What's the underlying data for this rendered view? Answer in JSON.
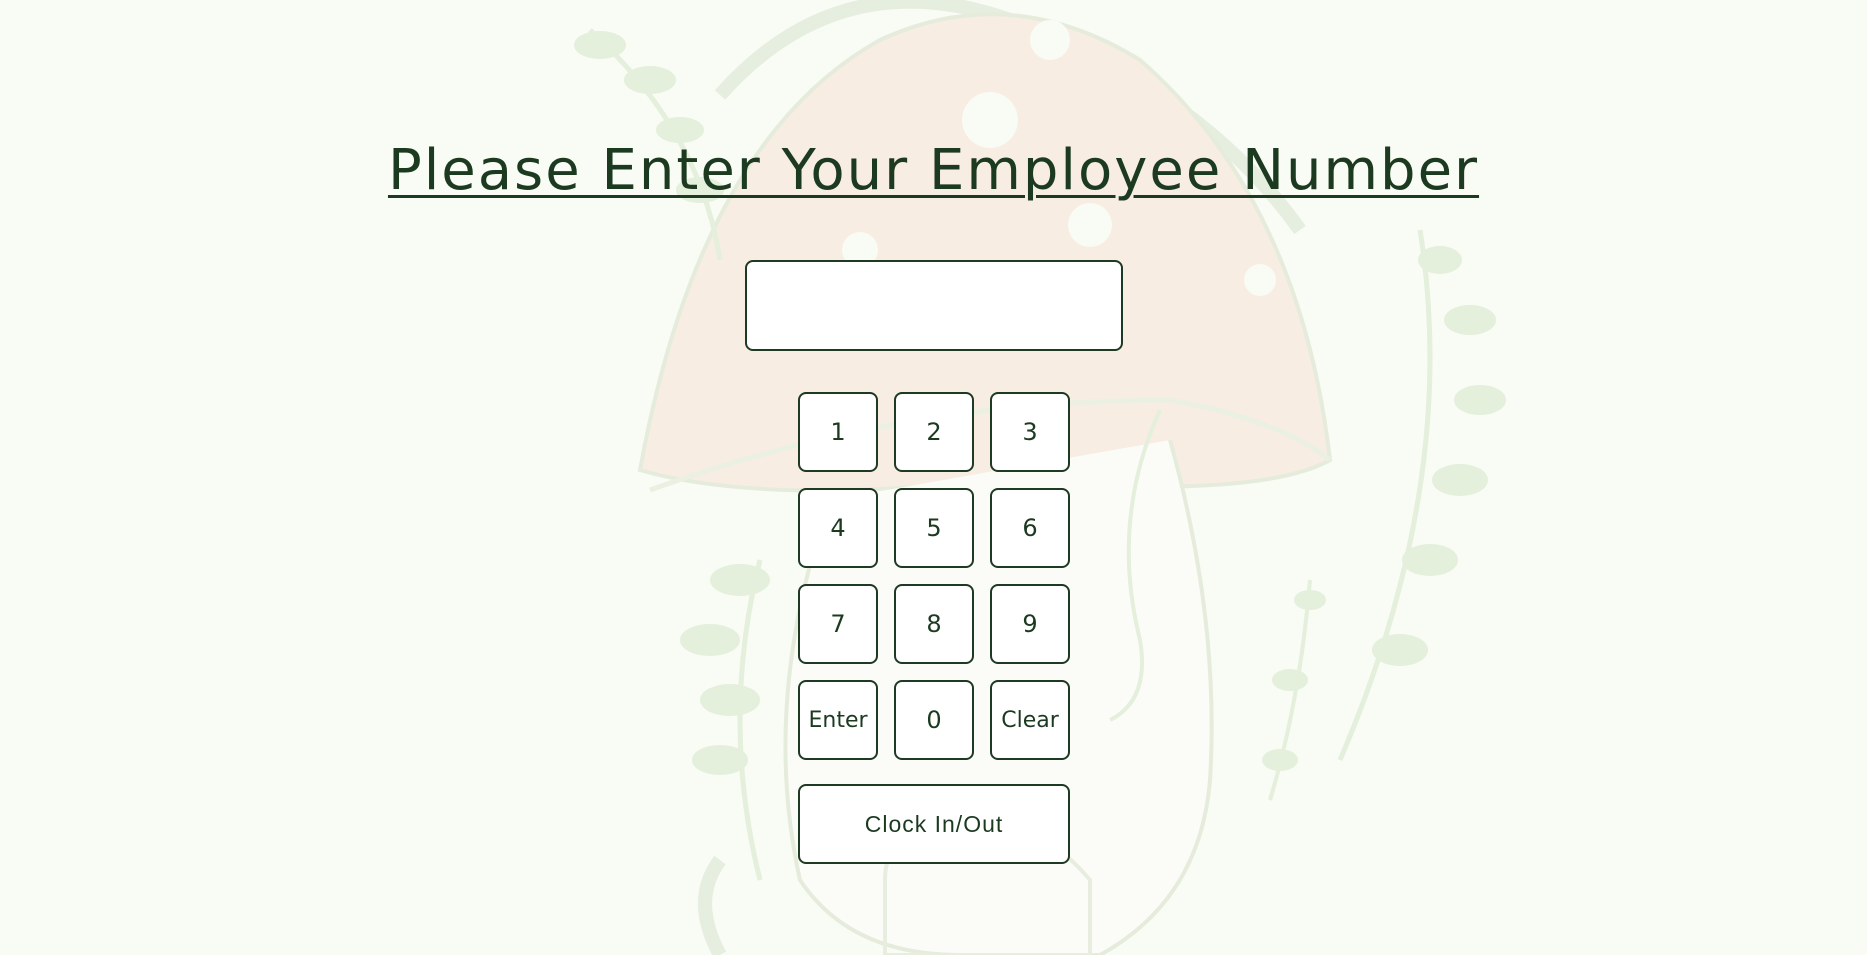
{
  "page": {
    "title": "Please Enter Your Employee Number"
  },
  "employee_input": {
    "value": "",
    "placeholder": ""
  },
  "keypad": {
    "keys": [
      "1",
      "2",
      "3",
      "4",
      "5",
      "6",
      "7",
      "8",
      "9",
      "Enter",
      "0",
      "Clear"
    ]
  },
  "clock_button": {
    "label": "Clock In/Out"
  },
  "background": {
    "icon": "mushroom-logo-watermark"
  },
  "colors": {
    "background": "#f9fbf5",
    "text": "#1c3a20",
    "border": "#1f3a22",
    "mushroom_cap": "#f7ede2",
    "leaf": "#e4efdc"
  }
}
